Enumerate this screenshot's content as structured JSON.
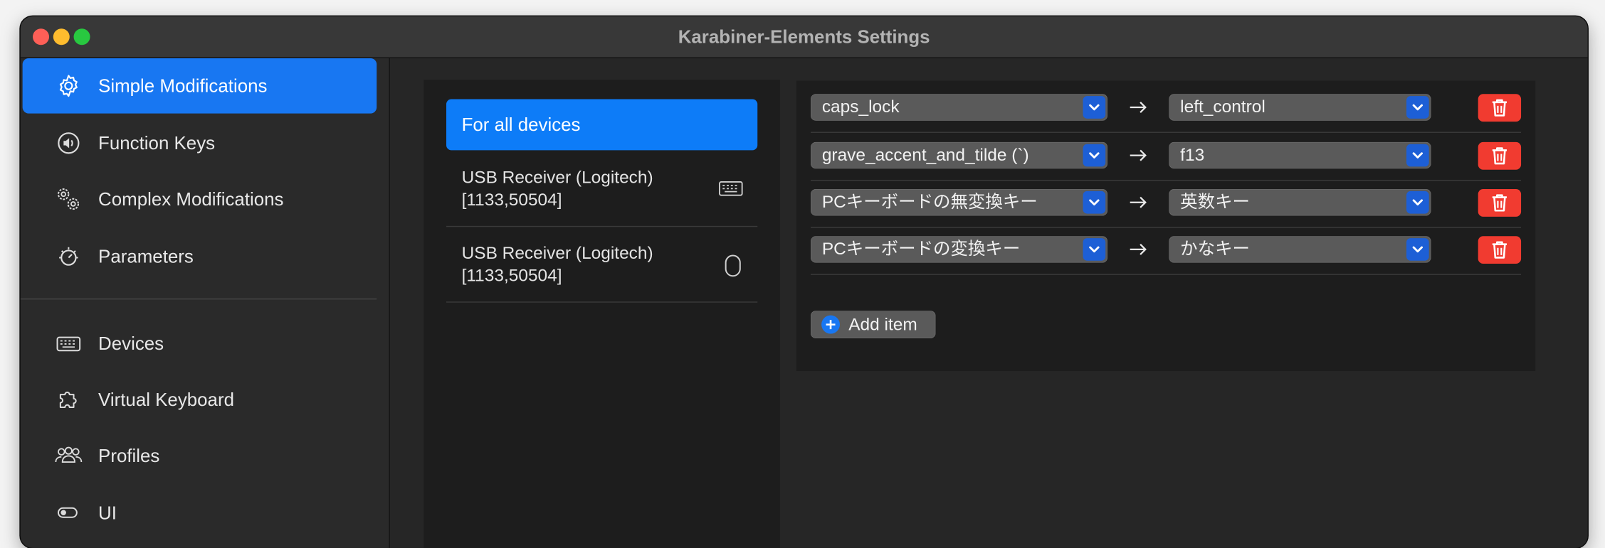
{
  "window": {
    "title": "Karabiner-Elements Settings"
  },
  "sidebar": {
    "items": [
      {
        "label": "Simple Modifications",
        "icon": "gear-icon",
        "active": true
      },
      {
        "label": "Function Keys",
        "icon": "speaker-icon",
        "active": false
      },
      {
        "label": "Complex Modifications",
        "icon": "gears-icon",
        "active": false
      },
      {
        "label": "Parameters",
        "icon": "dial-icon",
        "active": false
      },
      {
        "label": "Devices",
        "icon": "keyboard-icon",
        "active": false
      },
      {
        "label": "Virtual Keyboard",
        "icon": "puzzle-icon",
        "active": false
      },
      {
        "label": "Profiles",
        "icon": "people-icon",
        "active": false
      },
      {
        "label": "UI",
        "icon": "toggle-icon",
        "active": false
      }
    ]
  },
  "devices": {
    "items": [
      {
        "label": "For all devices",
        "active": true
      },
      {
        "line1": "USB Receiver (Logitech)",
        "line2": "[1133,50504]",
        "icon": "keyboard-icon"
      },
      {
        "line1": "USB Receiver (Logitech)",
        "line2": "[1133,50504]",
        "icon": "mouse-icon"
      }
    ]
  },
  "mappings": {
    "rows": [
      {
        "from": "caps_lock",
        "to": "left_control"
      },
      {
        "from": "grave_accent_and_tilde (`)",
        "to": "f13"
      },
      {
        "from": "PCキーボードの無変換キー",
        "to": "英数キー"
      },
      {
        "from": "PCキーボードの変換キー",
        "to": "かなキー"
      }
    ],
    "add_label": "Add item"
  },
  "colors": {
    "accent": "#1877f2",
    "delete": "#f13b30",
    "popup_chevron": "#1d5fd6"
  }
}
